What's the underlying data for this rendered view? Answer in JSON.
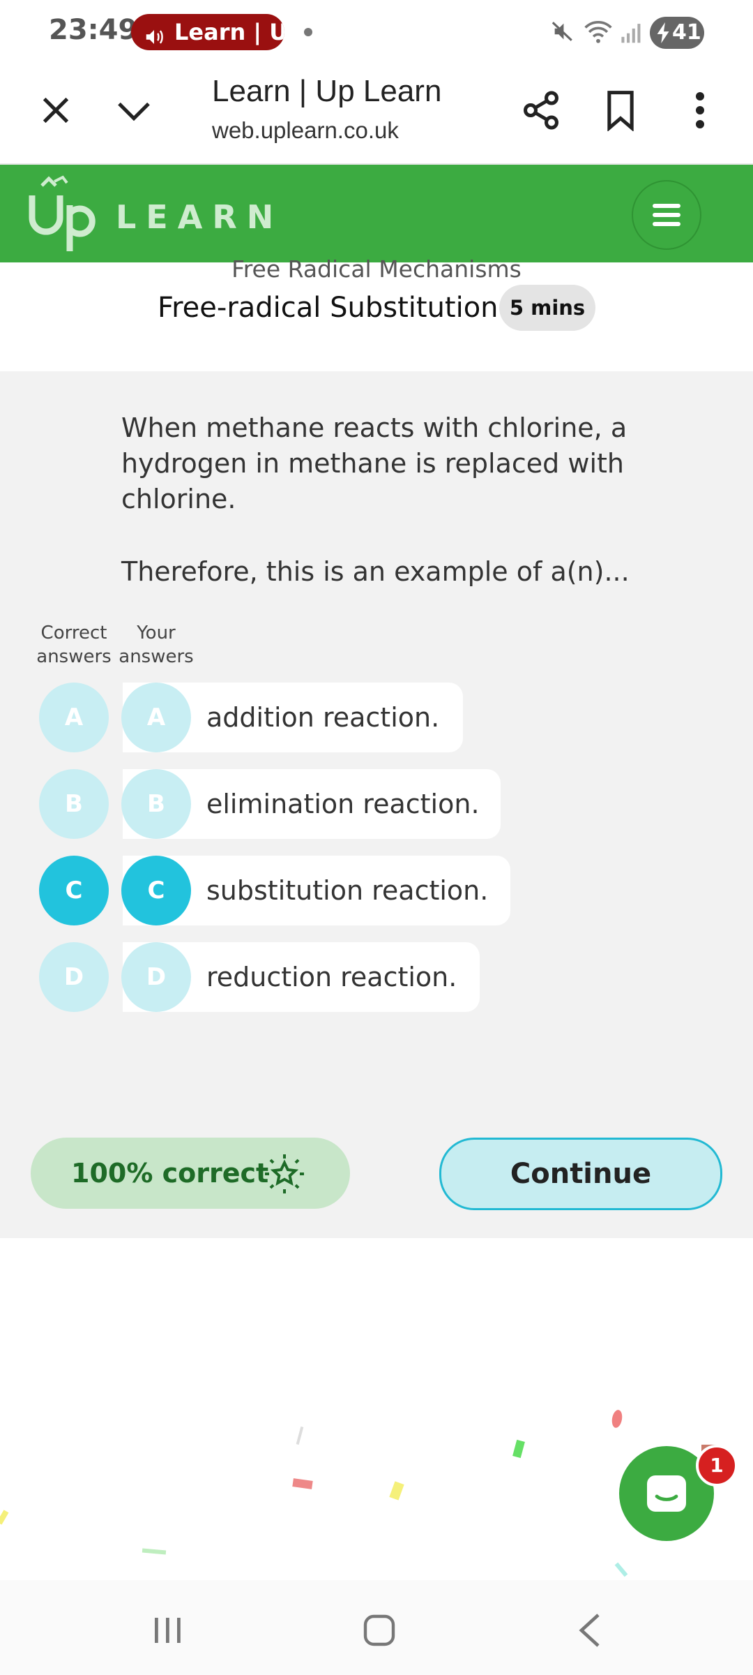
{
  "status_bar": {
    "time": "23:49",
    "media_label": "Learn | Up",
    "battery": "41"
  },
  "browser": {
    "page_title": "Learn | Up Learn",
    "url": "web.uplearn.co.uk"
  },
  "app": {
    "logo_text": "LEARN",
    "brand_color": "#3cab41"
  },
  "lesson": {
    "breadcrumb": "Free Radical Mechanisms",
    "title": "Free-radical Substitution",
    "duration": "5 mins"
  },
  "question": {
    "text_1": "When methane reacts with chlorine, a hydrogen in methane is replaced with chlorine.",
    "text_2": "Therefore, this is an example of a(n)...",
    "header_correct": "Correct answers",
    "header_your": "Your answers",
    "options": [
      {
        "letter": "A",
        "label": "addition reaction.",
        "selected": false
      },
      {
        "letter": "B",
        "label": "elimination reaction.",
        "selected": false
      },
      {
        "letter": "C",
        "label": "substitution reaction.",
        "selected": true
      },
      {
        "letter": "D",
        "label": "reduction reaction.",
        "selected": false
      }
    ]
  },
  "result": {
    "score_text": "100% correct",
    "continue_label": "Continue"
  },
  "chat": {
    "badge_count": "1"
  }
}
